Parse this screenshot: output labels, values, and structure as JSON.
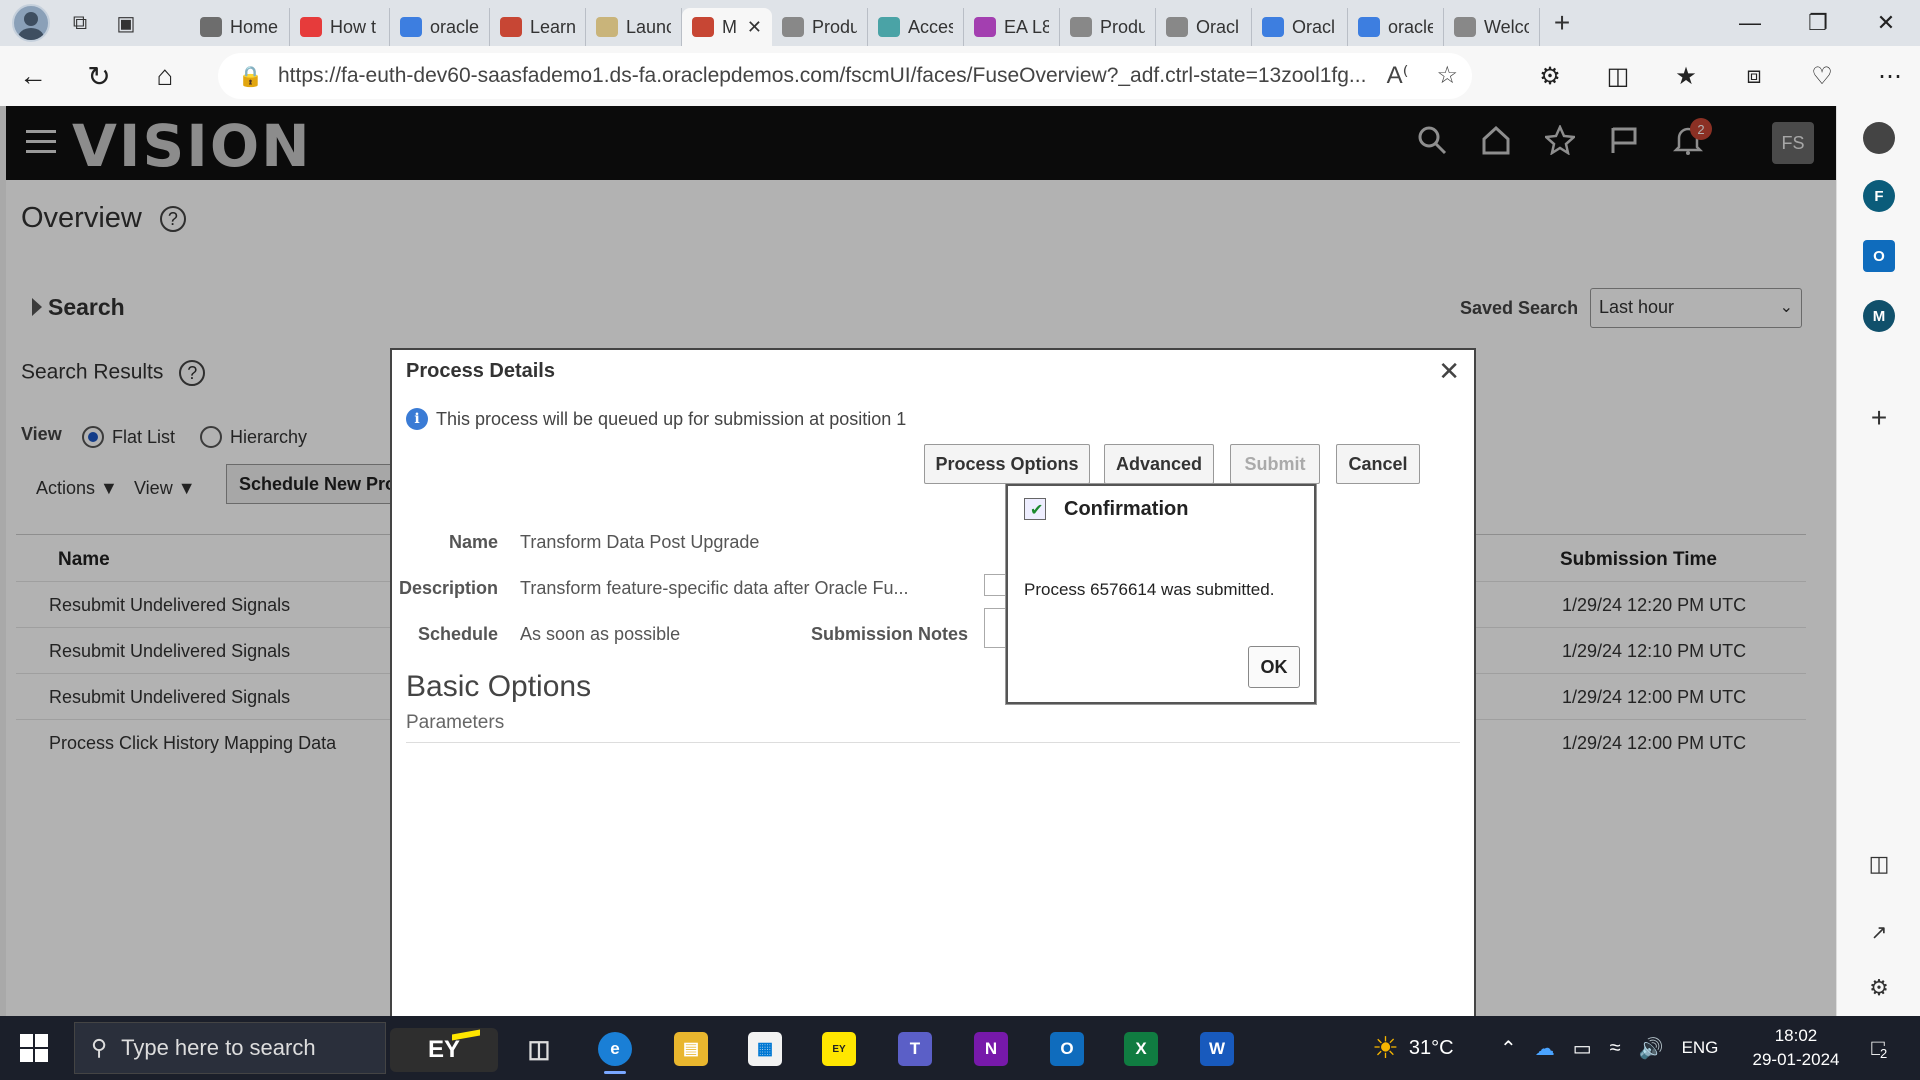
{
  "browser": {
    "tabs": [
      {
        "label": "Home",
        "color": "#6d6d6d"
      },
      {
        "label": "How t",
        "color": "#e63b3b"
      },
      {
        "label": "oracle",
        "color": "#3d7ee0"
      },
      {
        "label": "Learn",
        "color": "#c74634"
      },
      {
        "label": "Launc",
        "color": "#c9b47a"
      },
      {
        "label": "M",
        "color": "#c74634"
      },
      {
        "label": "Produ",
        "color": "#888888"
      },
      {
        "label": "Acces",
        "color": "#4aa3a6"
      },
      {
        "label": "EA L8",
        "color": "#a33fb0"
      },
      {
        "label": "Produ",
        "color": "#888888"
      },
      {
        "label": "Oracl",
        "color": "#888888"
      },
      {
        "label": "Oracl",
        "color": "#3d7ee0"
      },
      {
        "label": "oracle",
        "color": "#3d7ee0"
      },
      {
        "label": "Welco",
        "color": "#888888"
      }
    ],
    "url": "https://fa-euth-dev60-saasfademo1.ds-fa.oraclepdemos.com/fscmUI/faces/FuseOverview?_adf.ctrl-state=13zool1fg..."
  },
  "edge_sidebar": {
    "items": [
      {
        "letter": "",
        "color": "#444444"
      },
      {
        "letter": "F",
        "color": "#0b5c7a"
      },
      {
        "letter": "",
        "color": "#0f6cbd"
      },
      {
        "letter": "M",
        "color": "#10506b"
      }
    ]
  },
  "app": {
    "logo": "VISION",
    "notification_count": "2",
    "user_initials": "FS"
  },
  "overview": {
    "title": "Overview",
    "search_label": "Search",
    "saved_search_label": "Saved Search",
    "saved_search_value": "Last hour",
    "search_results_label": "Search Results",
    "view_label": "View",
    "radio_flat": "Flat List",
    "radio_hierarchy": "Hierarchy",
    "actions_label": "Actions",
    "view_menu_label": "View",
    "schedule_button": "Schedule New Process",
    "columns": {
      "name": "Name",
      "submission_time": "Submission Time"
    },
    "rows": [
      {
        "name": "Resubmit Undelivered Signals",
        "time": "1/29/24 12:20 PM UTC"
      },
      {
        "name": "Resubmit Undelivered Signals",
        "time": "1/29/24 12:10 PM UTC"
      },
      {
        "name": "Resubmit Undelivered Signals",
        "time": "1/29/24 12:00 PM UTC"
      },
      {
        "name": "Process Click History Mapping Data",
        "time": "1/29/24 12:00 PM UTC"
      }
    ]
  },
  "process_dialog": {
    "title": "Process Details",
    "info": "This process will be queued up for submission at position 1",
    "buttons": {
      "process_options": "Process Options",
      "advanced": "Advanced",
      "submit": "Submit",
      "cancel": "Cancel"
    },
    "fields": {
      "name_label": "Name",
      "name_value": "Transform Data Post Upgrade",
      "description_label": "Description",
      "description_value": "Transform feature-specific data after Oracle Fu...",
      "schedule_label": "Schedule",
      "schedule_value": "As soon as possible",
      "submission_notes_label": "Submission Notes"
    },
    "basic_options": "Basic Options",
    "parameters": "Parameters"
  },
  "confirmation": {
    "title": "Confirmation",
    "message": "Process 6576614 was submitted.",
    "ok": "OK"
  },
  "taskbar": {
    "search_placeholder": "Type here to search",
    "ey_label": "EY",
    "temperature": "31°C",
    "language": "ENG",
    "time": "18:02",
    "date": "29-01-2024",
    "notification_count": "2"
  }
}
